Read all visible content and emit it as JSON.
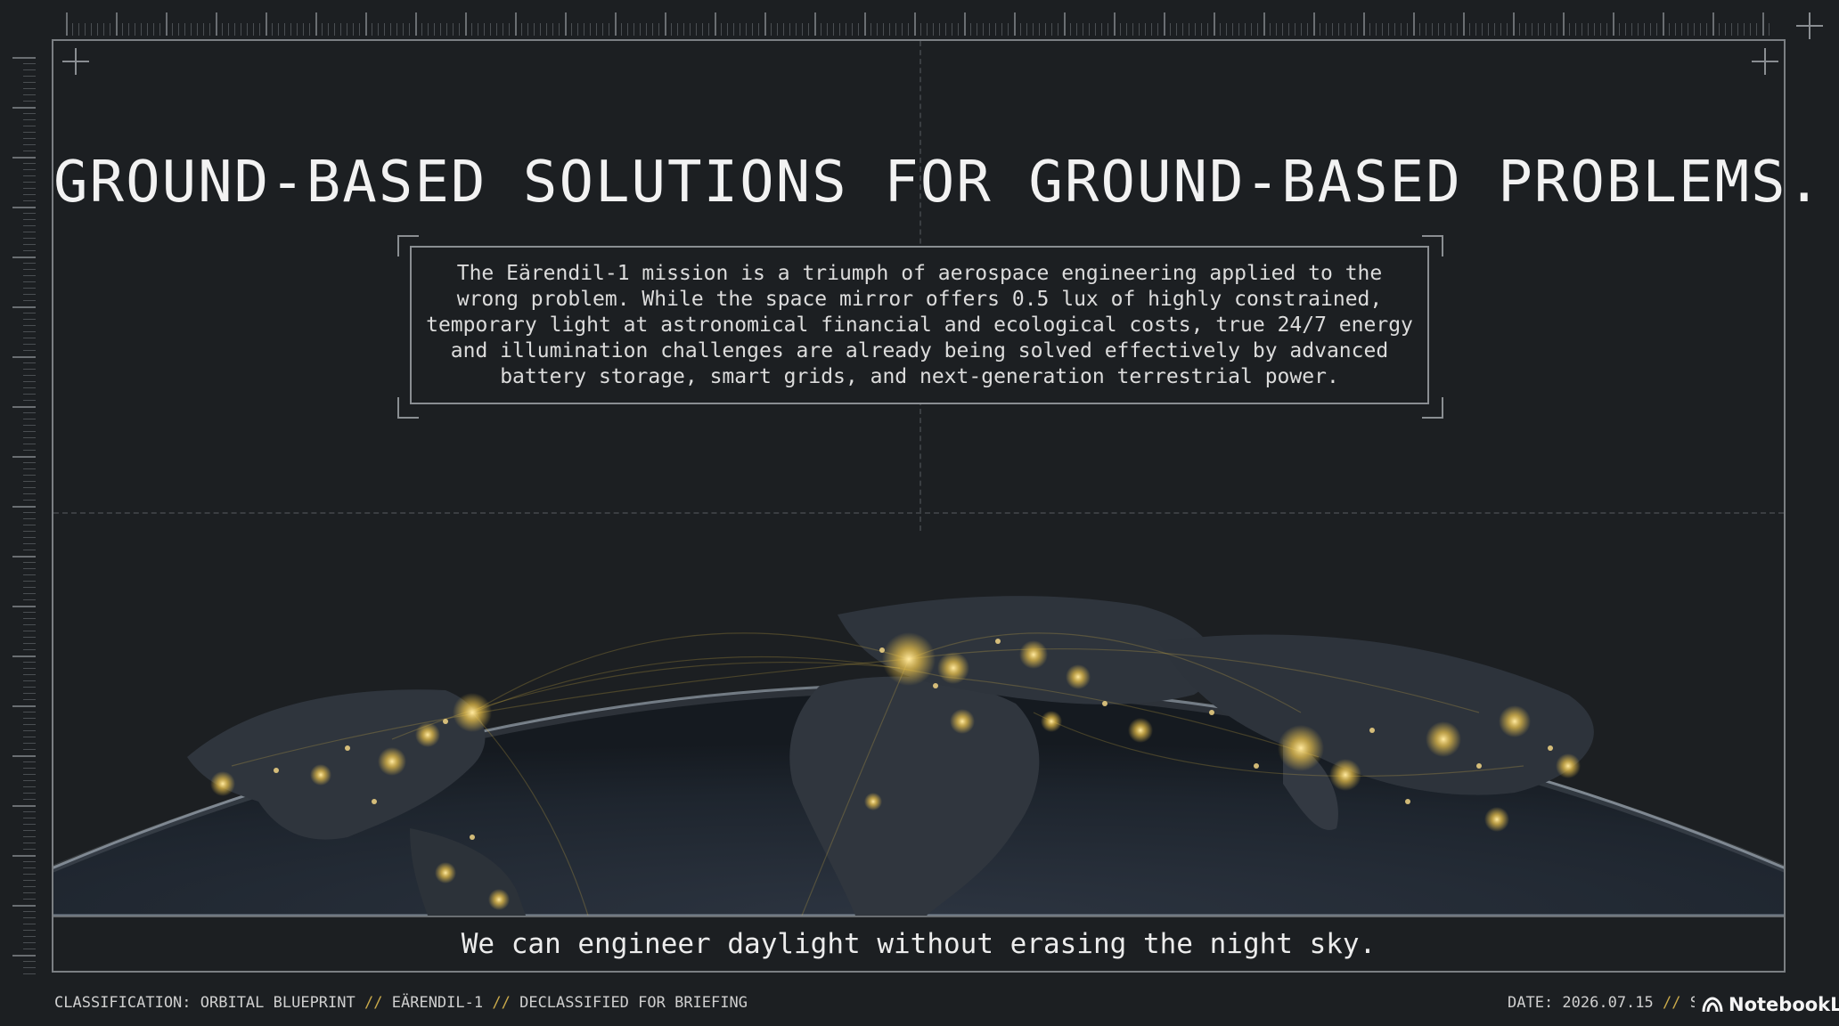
{
  "slide": {
    "title": "GROUND-BASED SOLUTIONS FOR GROUND-BASED PROBLEMS.",
    "description": "The Eärendil-1 mission is a triumph of aerospace engineering applied to the wrong problem. While the space mirror offers 0.5 lux of highly constrained, temporary light at astronomical financial and ecological costs, true 24/7 energy and illumination challenges are already being solved effectively by advanced battery storage, smart grids, and next-generation terrestrial power.",
    "caption": "We can engineer daylight without erasing the night sky."
  },
  "footer": {
    "classification": "CLASSIFICATION: ORBITAL BLUEPRINT",
    "separator": "//",
    "mission": "EÄRENDIL-1",
    "status": "DECLASSIFIED FOR BRIEFING",
    "date": "DATE: 2026.07.15",
    "truncated": "S"
  },
  "brand": {
    "name": "NotebookLM",
    "icon": "notebooklm-logo-icon"
  },
  "colors": {
    "background": "#1c1f22",
    "frame": "#7b7f83",
    "accent": "#c9a94a",
    "city_lights": "#f3c84b"
  }
}
